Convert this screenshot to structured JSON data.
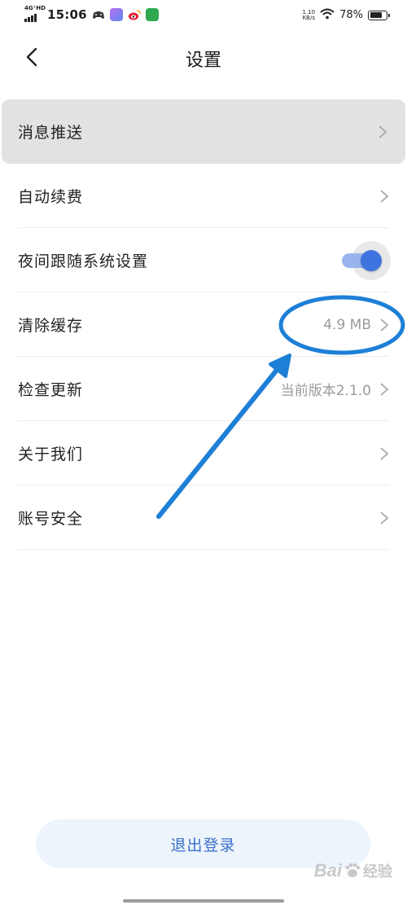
{
  "status_bar": {
    "network": "4G⁺HD",
    "time": "15:06",
    "speed_value": "1.10",
    "speed_unit": "KB/s",
    "battery": "78%",
    "battery_level": 0.78,
    "app_icons": [
      "game-controller-icon",
      "app-icon",
      "weibo-icon",
      "wechat-app-icon"
    ]
  },
  "header": {
    "title": "设置"
  },
  "settings": {
    "items": [
      {
        "label": "消息推送"
      },
      {
        "label": "自动续费"
      },
      {
        "label": "夜间跟随系统设置",
        "toggle_on": true
      },
      {
        "label": "清除缓存",
        "value": "4.9 MB"
      },
      {
        "label": "检查更新",
        "value": "当前版本2.1.0"
      },
      {
        "label": "关于我们"
      },
      {
        "label": "账号安全"
      }
    ]
  },
  "logout": {
    "label": "退出登录"
  },
  "watermark": {
    "bai": "Bai",
    "jy": "经验"
  },
  "colors": {
    "accent": "#3f74e0",
    "annotation": "#1e7fd6",
    "logout_bg": "#edf4fb",
    "logout_text": "#3a6fc9",
    "active_row": "#e2e2e2"
  }
}
